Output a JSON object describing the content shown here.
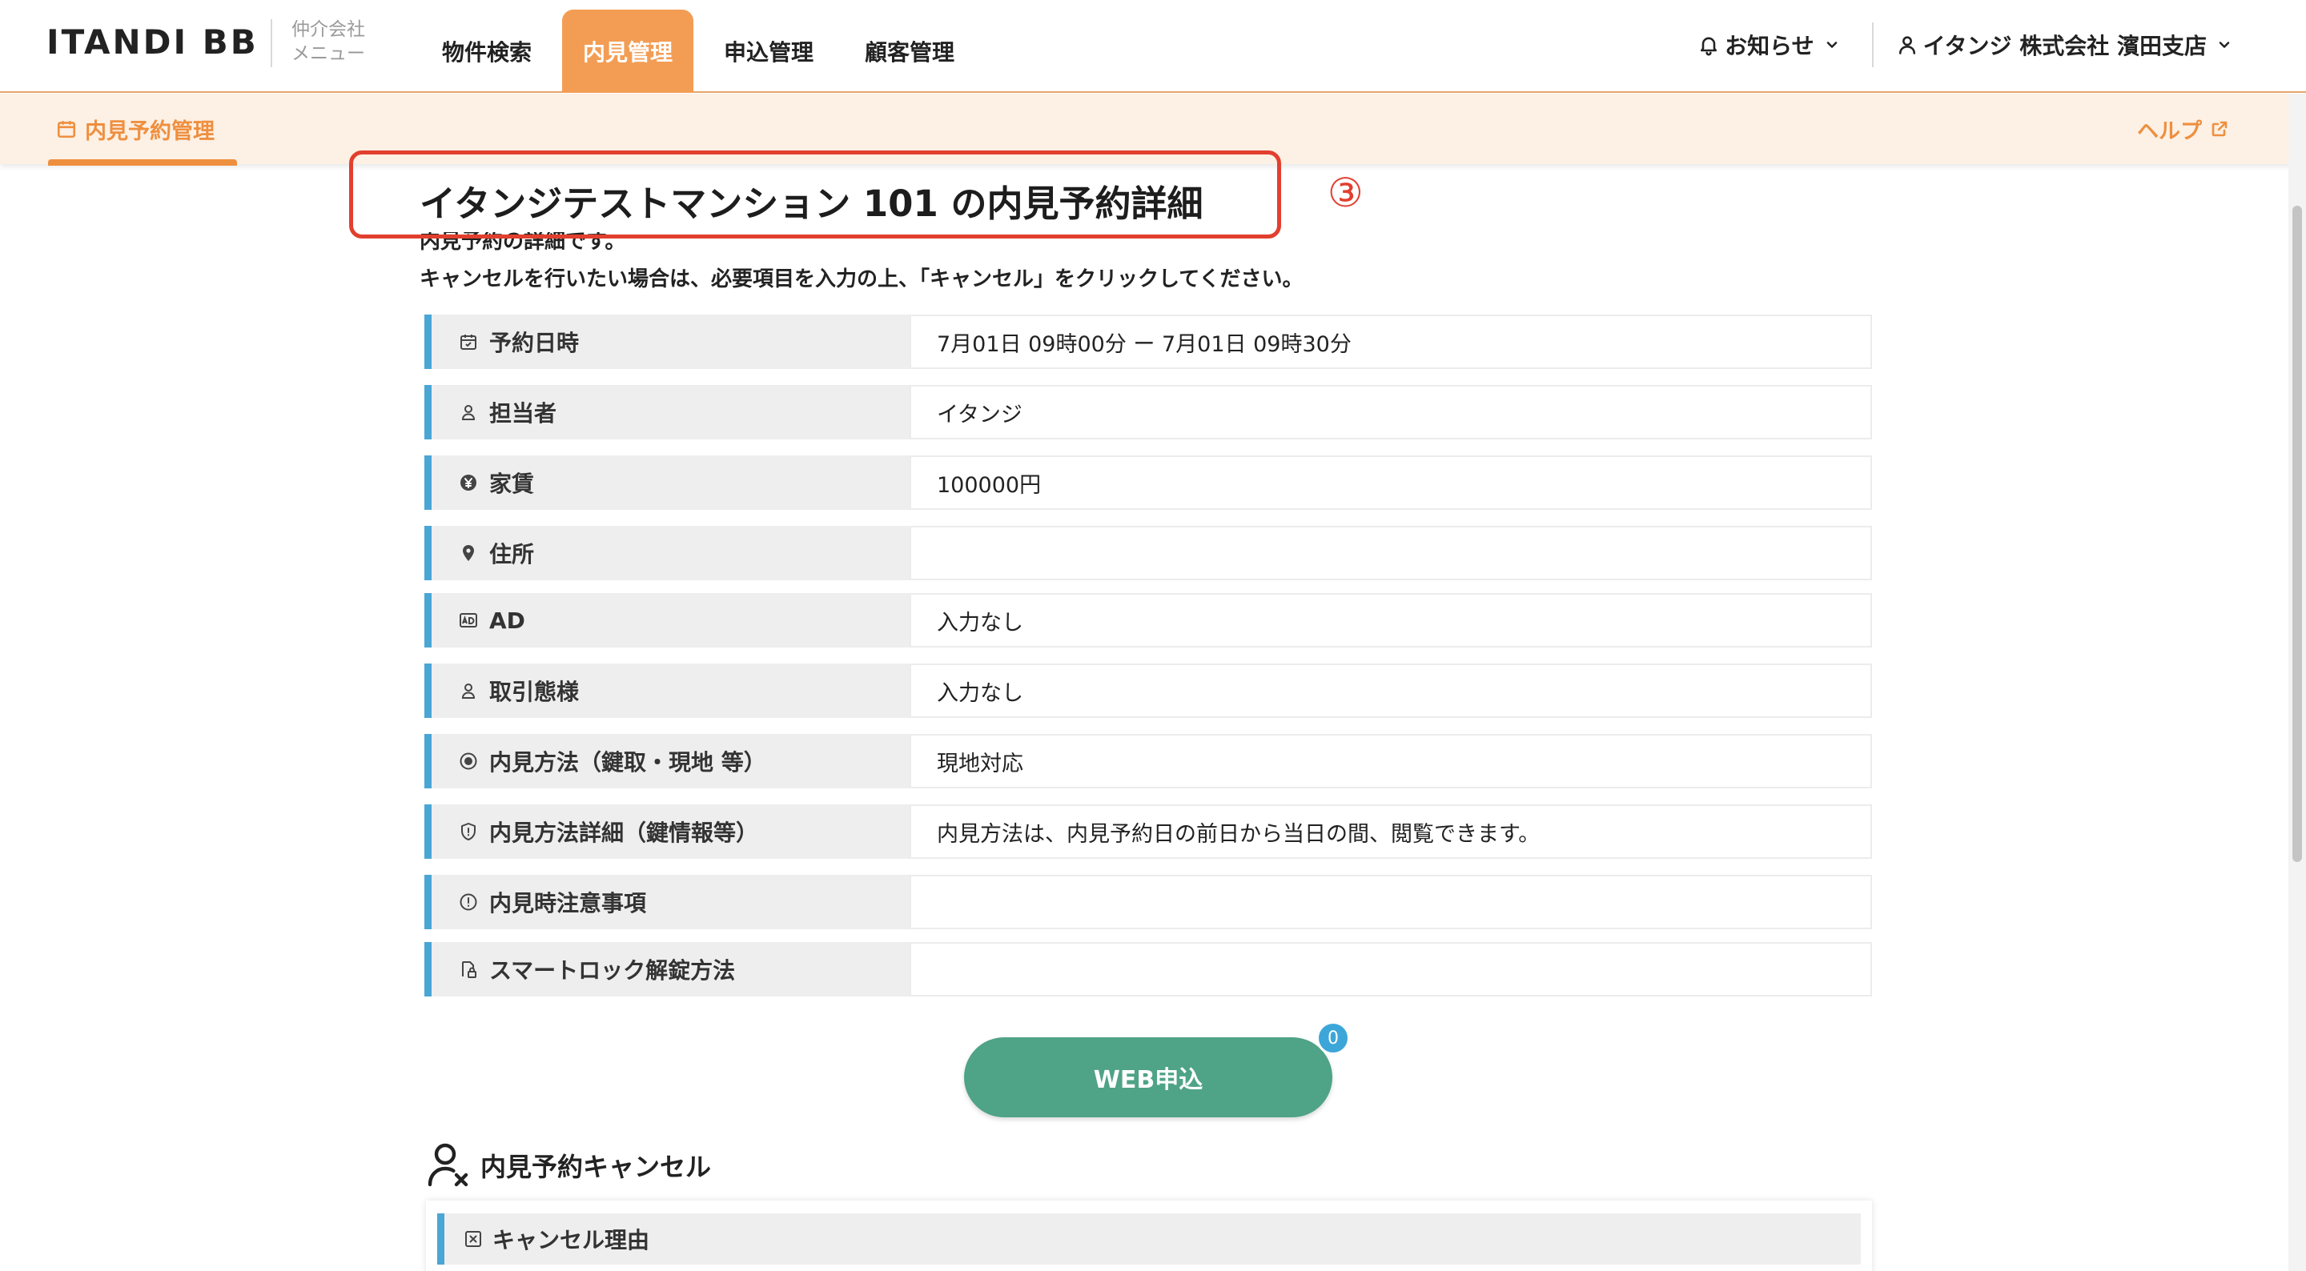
{
  "header": {
    "logo": "ITANDI BB",
    "logo_sub_line1": "仲介会社",
    "logo_sub_line2": "メニュー",
    "nav": [
      "物件検索",
      "内見管理",
      "申込管理",
      "顧客管理"
    ],
    "active_nav": "内見管理",
    "notice_label": "お知らせ",
    "account_label": "イタンジ 株式会社 濱田支店"
  },
  "subheader": {
    "tab_label": "内見予約管理",
    "help_label": "ヘルプ"
  },
  "page": {
    "title": "イタンジテストマンション 101 の内見予約詳細",
    "step_marker": "③",
    "description_line1": "内見予約の詳細です。",
    "description_line2": "キャンセルを行いたい場合は、必要項目を入力の上、「キャンセル」をクリックしてください。"
  },
  "details": [
    {
      "icon": "calendar-icon",
      "label": "予約日時",
      "value": "7月01日 09時00分 ー 7月01日 09時30分"
    },
    {
      "icon": "person-icon",
      "label": "担当者",
      "value": "イタンジ"
    },
    {
      "icon": "yen-icon",
      "label": "家賃",
      "value": "100000円"
    },
    {
      "icon": "location-pin-icon",
      "label": "住所",
      "value": ""
    },
    {
      "icon": "ad-icon",
      "label": "AD",
      "value": "入力なし"
    },
    {
      "icon": "person-icon",
      "label": "取引態様",
      "value": "入力なし"
    },
    {
      "icon": "target-icon",
      "label": "内見方法（鍵取・現地 等）",
      "value": "現地対応"
    },
    {
      "icon": "shield-icon",
      "label": "内見方法詳細（鍵情報等）",
      "value": "内見方法は、内見予約日の前日から当日の間、閲覧できます。"
    },
    {
      "icon": "alert-circle-icon",
      "label": "内見時注意事項",
      "value": ""
    },
    {
      "icon": "smart-lock-icon",
      "label": "スマートロック解錠方法",
      "value": ""
    }
  ],
  "web_apply": {
    "label": "WEB申込",
    "badge_count": "0"
  },
  "cancel_section": {
    "heading": "内見予約キャンセル",
    "reason_label": "キャンセル理由"
  },
  "colors": {
    "accent_orange": "#f39d54",
    "accent_blue": "#4aa6d4",
    "button_green": "#4fa386",
    "highlight_red": "#e23f2f"
  }
}
